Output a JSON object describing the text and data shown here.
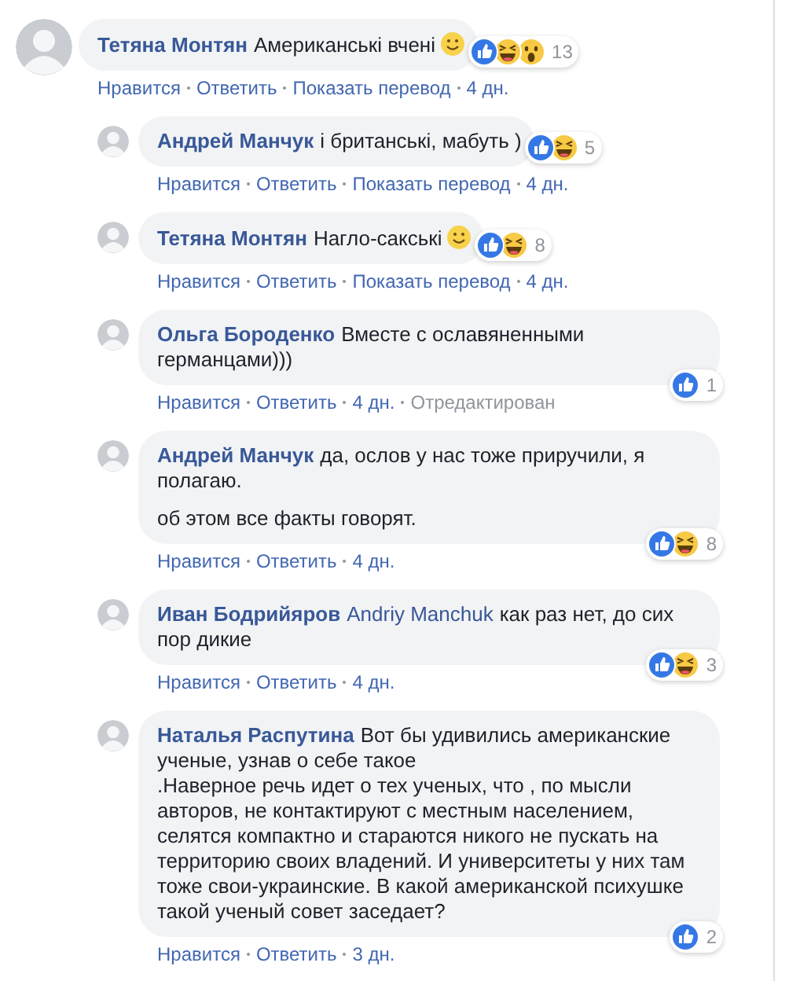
{
  "comments": [
    {
      "author": "Тетяна Монтян",
      "paragraphs": [
        "Американські вчені"
      ],
      "smiley": true,
      "reactions": [
        {
          "kind": "like"
        },
        {
          "kind": "haha"
        },
        {
          "kind": "wow"
        }
      ],
      "reaction_count": "13",
      "actions": [
        {
          "label": "Нравится",
          "kind": "link"
        },
        {
          "label": "Ответить",
          "kind": "link"
        },
        {
          "label": "Показать перевод",
          "kind": "link"
        },
        {
          "label": "4 дн.",
          "kind": "link"
        }
      ],
      "children": [
        {
          "author": "Андрей Манчук",
          "paragraphs": [
            "і британські, мабуть )"
          ],
          "smiley": false,
          "reactions": [
            {
              "kind": "like"
            },
            {
              "kind": "haha"
            }
          ],
          "reaction_count": "5",
          "actions": [
            {
              "label": "Нравится",
              "kind": "link"
            },
            {
              "label": "Ответить",
              "kind": "link"
            },
            {
              "label": "Показать перевод",
              "kind": "link"
            },
            {
              "label": "4 дн.",
              "kind": "link"
            }
          ]
        },
        {
          "author": "Тетяна Монтян",
          "paragraphs": [
            "Нагло-сакські"
          ],
          "smiley": true,
          "reactions": [
            {
              "kind": "like"
            },
            {
              "kind": "haha"
            }
          ],
          "reaction_count": "8",
          "actions": [
            {
              "label": "Нравится",
              "kind": "link"
            },
            {
              "label": "Ответить",
              "kind": "link"
            },
            {
              "label": "Показать перевод",
              "kind": "link"
            },
            {
              "label": "4 дн.",
              "kind": "link"
            }
          ]
        },
        {
          "author": "Ольга Бороденко",
          "paragraphs": [
            "Вместе с ославяненными германцами)))"
          ],
          "smiley": false,
          "reactions": [
            {
              "kind": "like"
            }
          ],
          "reaction_count": "1",
          "actions": [
            {
              "label": "Нравится",
              "kind": "link"
            },
            {
              "label": "Ответить",
              "kind": "link"
            },
            {
              "label": "4 дн.",
              "kind": "link"
            },
            {
              "label": "Отредактирован",
              "kind": "note"
            }
          ]
        },
        {
          "author": "Андрей Манчук",
          "paragraphs": [
            "да, ослов у нас тоже приручили, я полагаю.",
            "об этом все факты говорят."
          ],
          "smiley": false,
          "reactions": [
            {
              "kind": "like"
            },
            {
              "kind": "haha"
            }
          ],
          "reaction_count": "8",
          "actions": [
            {
              "label": "Нравится",
              "kind": "link"
            },
            {
              "label": "Ответить",
              "kind": "link"
            },
            {
              "label": "4 дн.",
              "kind": "link"
            }
          ]
        },
        {
          "author": "Иван Бодрийяров",
          "mention": "Andriy Manchuk",
          "paragraphs": [
            "как раз нет, до сих пор дикие"
          ],
          "smiley": false,
          "reactions": [
            {
              "kind": "like"
            },
            {
              "kind": "haha"
            }
          ],
          "reaction_count": "3",
          "actions": [
            {
              "label": "Нравится",
              "kind": "link"
            },
            {
              "label": "Ответить",
              "kind": "link"
            },
            {
              "label": "4 дн.",
              "kind": "link"
            }
          ]
        },
        {
          "author": "Наталья Распутина",
          "paragraphs": [
            "Вот бы удивились американские ученые, узнав о себе такое\n.Наверное речь идет о тех ученых, что , по мысли авторов, не контактируют с местным населением, селятся компактно и стараются никого не пускать на территорию своих владений. И университеты у них там тоже свои-украинские. В какой американской психушке такой ученый совет заседает?"
          ],
          "smiley": false,
          "reactions": [
            {
              "kind": "like"
            }
          ],
          "reaction_count": "2",
          "actions": [
            {
              "label": "Нравится",
              "kind": "link"
            },
            {
              "label": "Ответить",
              "kind": "link"
            },
            {
              "label": "3 дн.",
              "kind": "link"
            }
          ]
        }
      ]
    }
  ]
}
